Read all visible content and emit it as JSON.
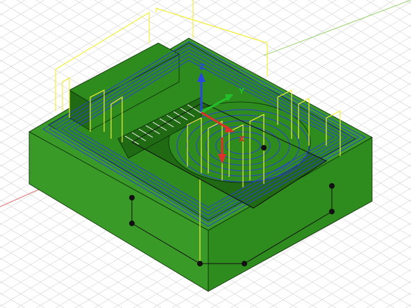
{
  "viewport": {
    "title": "",
    "background": "#ffffff",
    "grid_color": "#d2d2d2"
  },
  "model": {
    "body_color": "#2e8b1e",
    "top_color": "#3a9a28",
    "side_dark": "#1f6a12",
    "toolpath_color": "#2b3fd6",
    "linking_color": "#f2ef38",
    "edge_color": "#0a2a06"
  },
  "triad": {
    "x_label": "X",
    "y_label": "Y",
    "z_label": "Z",
    "x_color": "#e0302a",
    "y_color": "#22c02a",
    "z_color": "#2a46e0",
    "tool_color": "#e0302a"
  },
  "origin_axes": {
    "red_color": "#e06a6a",
    "green_color": "#9ad16a"
  }
}
